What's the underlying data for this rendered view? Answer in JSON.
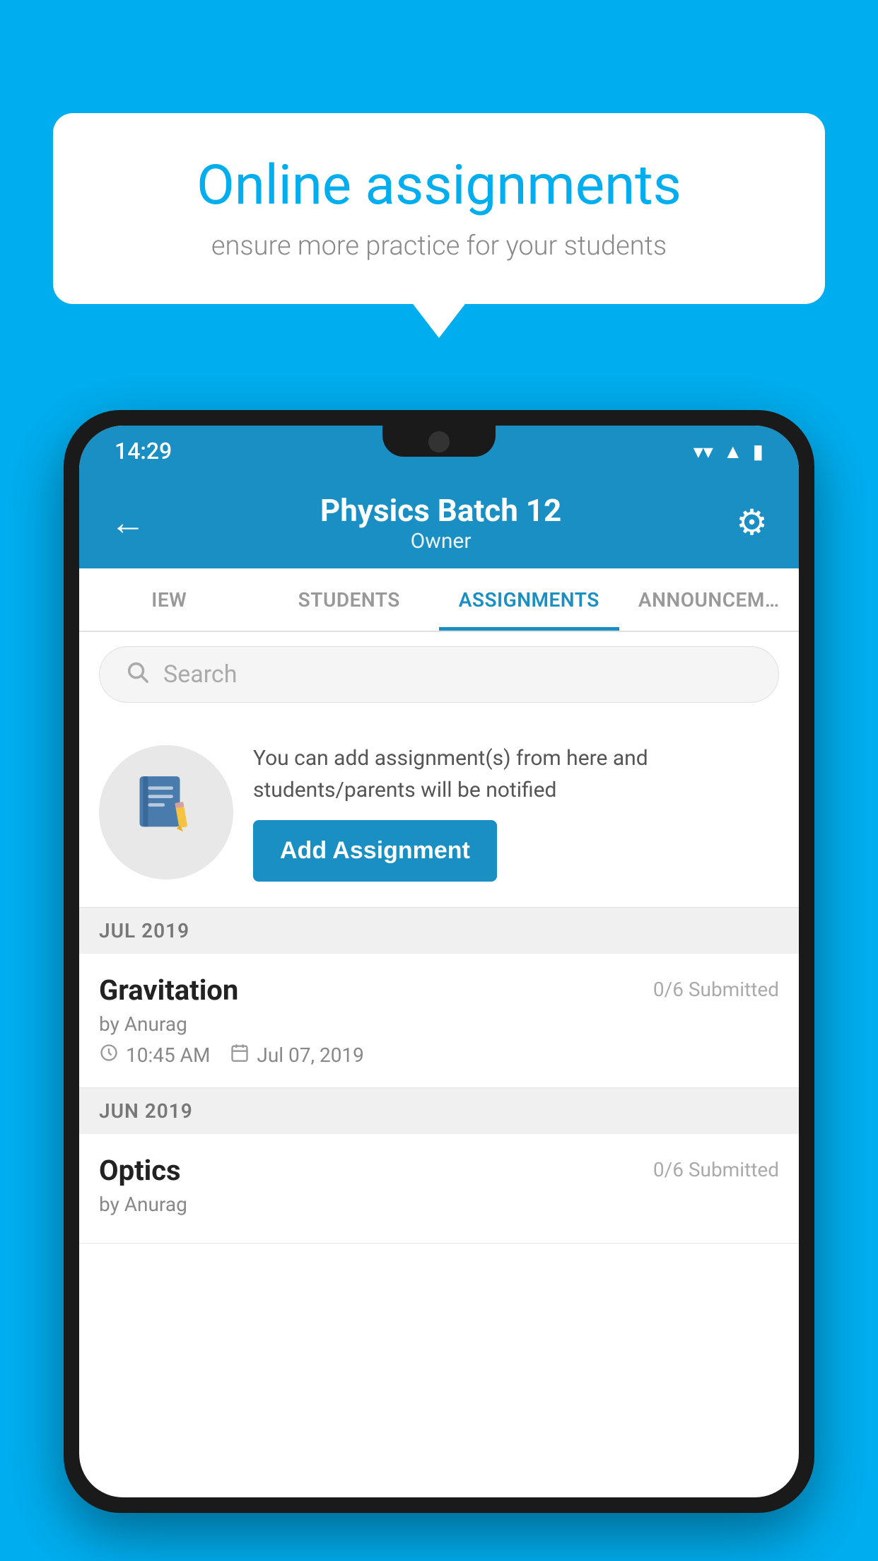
{
  "background_color": "#00AEEF",
  "speech_bubble": {
    "title": "Online assignments",
    "subtitle": "ensure more practice for your students"
  },
  "status_bar": {
    "time": "14:29",
    "icons": [
      "wifi",
      "signal",
      "battery"
    ]
  },
  "app_bar": {
    "title": "Physics Batch 12",
    "subtitle": "Owner",
    "back_icon": "←",
    "settings_icon": "⚙"
  },
  "tabs": [
    {
      "label": "IEW",
      "active": false
    },
    {
      "label": "STUDENTS",
      "active": false
    },
    {
      "label": "ASSIGNMENTS",
      "active": true
    },
    {
      "label": "ANNOUNCEM…",
      "active": false
    }
  ],
  "search": {
    "placeholder": "Search"
  },
  "promo": {
    "icon": "📓",
    "text": "You can add assignment(s) from here and students/parents will be notified",
    "button_label": "Add Assignment"
  },
  "sections": [
    {
      "month_label": "JUL 2019",
      "assignments": [
        {
          "name": "Gravitation",
          "submitted": "0/6 Submitted",
          "by": "by Anurag",
          "time": "10:45 AM",
          "date": "Jul 07, 2019"
        }
      ]
    },
    {
      "month_label": "JUN 2019",
      "assignments": [
        {
          "name": "Optics",
          "submitted": "0/6 Submitted",
          "by": "by Anurag",
          "time": "",
          "date": ""
        }
      ]
    }
  ]
}
